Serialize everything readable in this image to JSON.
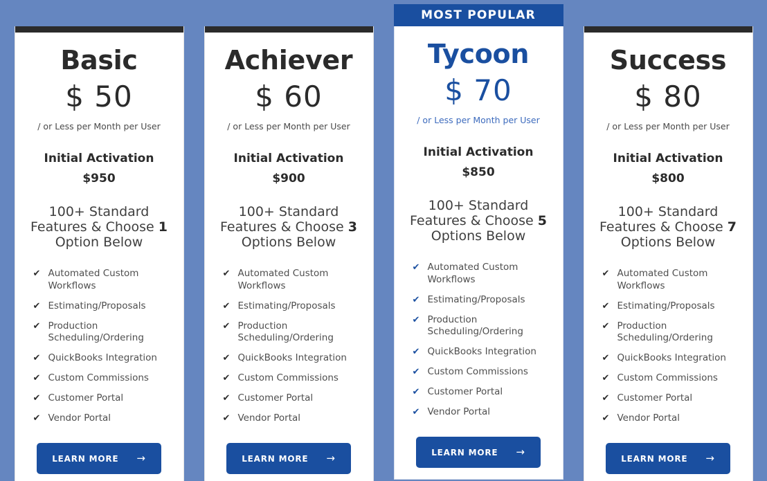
{
  "background_color": "#6586c0",
  "accent_color": "#1a4fa0",
  "dark_bar_color": "#2b2b2b",
  "featured_banner": {
    "label": "MOST POPULAR"
  },
  "cta": {
    "label": "LEARN MORE",
    "arrow_icon": "→"
  },
  "tick_icon": "✔",
  "plans": [
    {
      "name": "Basic",
      "price": "$ 50",
      "period": "/ or Less per Month per User",
      "activation_label": "Initial Activation",
      "activation_amount": "$950",
      "choose_prefix": "100+ Standard Features & Choose ",
      "choose_count": "1",
      "choose_suffix": " Option Below",
      "featured": false,
      "features": [
        "Automated Custom Workflows",
        "Estimating/Proposals",
        "Production Scheduling/Ordering",
        "QuickBooks Integration",
        "Custom Commissions",
        "Customer Portal",
        "Vendor Portal"
      ]
    },
    {
      "name": "Achiever",
      "price": "$ 60",
      "period": "/ or Less per Month per User",
      "activation_label": "Initial Activation",
      "activation_amount": "$900",
      "choose_prefix": "100+ Standard Features & Choose ",
      "choose_count": "3",
      "choose_suffix": " Options Below",
      "featured": false,
      "features": [
        "Automated Custom Workflows",
        "Estimating/Proposals",
        "Production Scheduling/Ordering",
        "QuickBooks Integration",
        "Custom Commissions",
        "Customer Portal",
        "Vendor Portal"
      ]
    },
    {
      "name": "Tycoon",
      "price": "$ 70",
      "period": "/ or Less per Month per User",
      "activation_label": "Initial Activation",
      "activation_amount": "$850",
      "choose_prefix": "100+ Standard Features & Choose ",
      "choose_count": "5",
      "choose_suffix": " Options Below",
      "featured": true,
      "features": [
        "Automated Custom Workflows",
        "Estimating/Proposals",
        "Production Scheduling/Ordering",
        "QuickBooks Integration",
        "Custom Commissions",
        "Customer Portal",
        "Vendor Portal"
      ]
    },
    {
      "name": "Success",
      "price": "$ 80",
      "period": "/ or Less per Month per User",
      "activation_label": "Initial Activation",
      "activation_amount": "$800",
      "choose_prefix": "100+ Standard Features & Choose ",
      "choose_count": "7",
      "choose_suffix": " Options Below",
      "featured": false,
      "features": [
        "Automated Custom Workflows",
        "Estimating/Proposals",
        "Production Scheduling/Ordering",
        "QuickBooks Integration",
        "Custom Commissions",
        "Customer Portal",
        "Vendor Portal"
      ]
    }
  ]
}
